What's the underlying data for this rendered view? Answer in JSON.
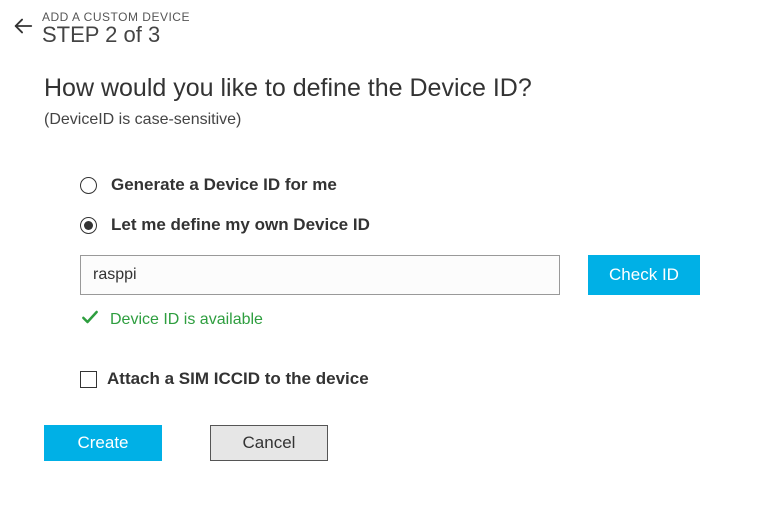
{
  "header": {
    "eyebrow": "ADD A CUSTOM DEVICE",
    "step": "STEP 2 of 3"
  },
  "title": "How would you like to define the Device ID?",
  "note": "(DeviceID is case-sensitive)",
  "options": {
    "generate": "Generate a Device ID for me",
    "define": "Let me define my own Device ID"
  },
  "device_id_value": "rasppi",
  "check_id_label": "Check ID",
  "availability_message": "Device ID is available",
  "sim_label": "Attach a SIM ICCID to the device",
  "buttons": {
    "create": "Create",
    "cancel": "Cancel"
  }
}
